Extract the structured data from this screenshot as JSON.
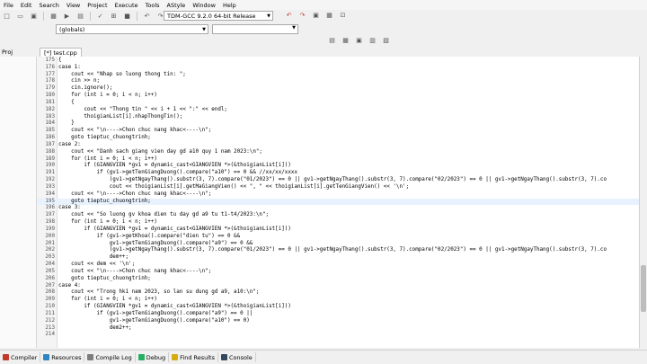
{
  "menu": [
    "File",
    "Edit",
    "Search",
    "View",
    "Project",
    "Execute",
    "Tools",
    "AStyle",
    "Window",
    "Help"
  ],
  "toolbar": {
    "compiler": "TDM-GCC 9.2.0 64-bit Release"
  },
  "scope": {
    "value": "(globals)"
  },
  "tabs": {
    "project_label": "Proj",
    "file_tab": "[*] test.cpp"
  },
  "colors": {
    "line_number": "#555555",
    "highlight": "#e8f2ff"
  },
  "code": {
    "highlight_line": 195,
    "lines": [
      {
        "n": "175",
        "t": "{"
      },
      {
        "n": "176",
        "t": "case 1:"
      },
      {
        "n": "177",
        "t": "    cout << \"Nhap so luong thong tin: \";"
      },
      {
        "n": "178",
        "t": "    cin >> n;"
      },
      {
        "n": "179",
        "t": "    cin.ignore();"
      },
      {
        "n": "180",
        "t": "    for (int i = 0; i < n; i++)"
      },
      {
        "n": "181",
        "t": "    {"
      },
      {
        "n": "182",
        "t": "        cout << \"Thong tin \" << i + 1 << \":\" << endl;"
      },
      {
        "n": "183",
        "t": "        thoigianList[i].nhapThongTin();"
      },
      {
        "n": "184",
        "t": "    }"
      },
      {
        "n": "185",
        "t": "    cout << \"\\n---->Chon chuc nang khac<----\\n\";"
      },
      {
        "n": "186",
        "t": "    goto tieptuc_chuongtrinh;"
      },
      {
        "n": "187",
        "t": "case 2:"
      },
      {
        "n": "188",
        "t": "    cout << \"Danh sach giang vien day gd a10 quy 1 nam 2023:\\n\";"
      },
      {
        "n": "189",
        "t": "    for (int i = 0; i < n; i++)"
      },
      {
        "n": "190",
        "t": "        if (GIANGVIEN *gv1 = dynamic_cast<GIANGVIEN *>(&thoigianList[i]))"
      },
      {
        "n": "191",
        "t": "            if (gv1->getTenGiangDuong().compare(\"a10\") == 0 && //xx/xx/xxxx"
      },
      {
        "n": "192",
        "t": "                (gv1->getNgayThang().substr(3, 7).compare(\"01/2023\") == 0 || gv1->getNgayThang().substr(3, 7).compare(\"02/2023\") == 0 || gv1->getNgayThang().substr(3, 7).co"
      },
      {
        "n": "193",
        "t": "                cout << thoigianList[i].getMaGiangVien() << \", \" << thoigianList[i].getTenGiangVien() << '\\n';"
      },
      {
        "n": "194",
        "t": "    cout << \"\\n---->Chon chuc nang khac<----\\n\";"
      },
      {
        "n": "195",
        "t": "    goto tieptuc_chuongtrinh;"
      },
      {
        "n": "196",
        "t": "case 3:"
      },
      {
        "n": "197",
        "t": "    cout << \"So luong gv khoa dien tu day gd a9 tu t1-t4/2023:\\n\";"
      },
      {
        "n": "198",
        "t": "    for (int i = 0; i < n; i++)"
      },
      {
        "n": "199",
        "t": "        if (GIANGVIEN *gv1 = dynamic_cast<GIANGVIEN *>(&thoigianList[i]))"
      },
      {
        "n": "200",
        "t": "            if (gv1->getKhoa().compare(\"dien tu\") == 0 &&"
      },
      {
        "n": "201",
        "t": "                gv1->getTenGiangDuong().compare(\"a9\") == 0 &&"
      },
      {
        "n": "202",
        "t": "                (gv1->getNgayThang().substr(3, 7).compare(\"01/2023\") == 0 || gv1->getNgayThang().substr(3, 7).compare(\"02/2023\") == 0 || gv1->getNgayThang().substr(3, 7).co"
      },
      {
        "n": "203",
        "t": "                dem++;"
      },
      {
        "n": "204",
        "t": "    cout << dem << '\\n';"
      },
      {
        "n": "205",
        "t": "    cout << \"\\n---->Chon chuc nang khac<----\\n\";"
      },
      {
        "n": "206",
        "t": "    goto tieptuc_chuongtrinh;"
      },
      {
        "n": "207",
        "t": "case 4:"
      },
      {
        "n": "208",
        "t": "    cout << \"Trong hk1 nam 2023, so lan su dung gd a9, a10:\\n\";"
      },
      {
        "n": "209",
        "t": "    for (int i = 0; i < n; i++)"
      },
      {
        "n": "210",
        "t": "        if (GIANGVIEN *gv1 = dynamic_cast<GIANGVIEN *>(&thoigianList[i]))"
      },
      {
        "n": "211",
        "t": "            if (gv1->getTenGiangDuong().compare(\"a9\") == 0 ||"
      },
      {
        "n": "212",
        "t": "                gv1->getTenGiangDuong().compare(\"a10\") == 0)"
      },
      {
        "n": "213",
        "t": "                dem2++;"
      },
      {
        "n": "214",
        "t": ""
      }
    ]
  },
  "bottom_tabs": [
    {
      "label": "Compiler",
      "icon": "compiler-icon",
      "color": "#c0392b"
    },
    {
      "label": "Resources",
      "icon": "resources-icon",
      "color": "#2e86c1"
    },
    {
      "label": "Compile Log",
      "icon": "compile-log-icon",
      "color": "#7d7d7d"
    },
    {
      "label": "Debug",
      "icon": "debug-icon",
      "color": "#27ae60"
    },
    {
      "label": "Find Results",
      "icon": "find-results-icon",
      "color": "#d4ac0d"
    },
    {
      "label": "Console",
      "icon": "console-icon",
      "color": "#34495e"
    }
  ]
}
